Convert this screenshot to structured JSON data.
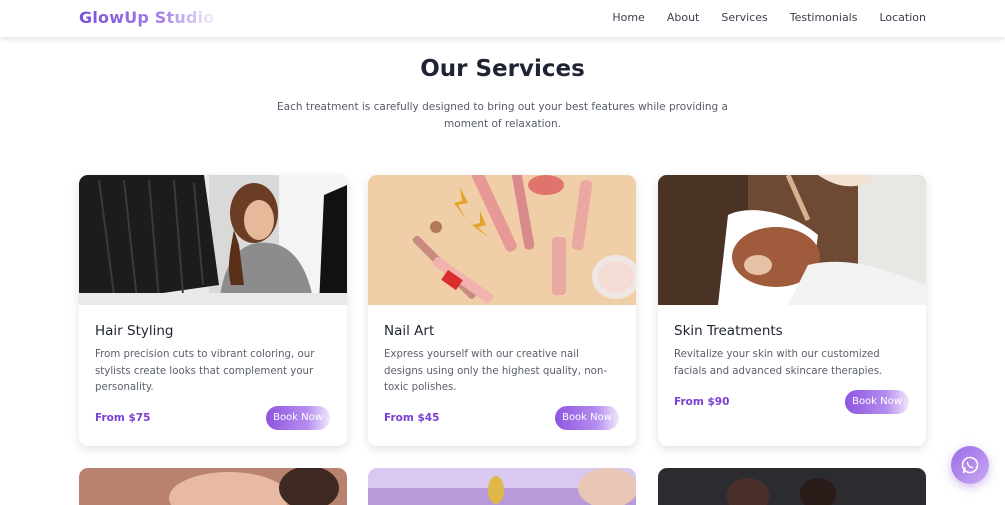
{
  "nav": {
    "brand": "GlowUp Studio",
    "items": [
      "Home",
      "About",
      "Services",
      "Testimonials",
      "Location"
    ]
  },
  "header": {
    "title": "Our Services",
    "subtitle": "Each treatment is carefully designed to bring out your best features while providing a moment of relaxation."
  },
  "services": [
    {
      "title": "Hair Styling",
      "description": "From precision cuts to vibrant coloring, our stylists create looks that complement your personality.",
      "price": "From $75",
      "button": "Book Now"
    },
    {
      "title": "Nail Art",
      "description": "Express yourself with our creative nail designs using only the highest quality, non-toxic polishes.",
      "price": "From $45",
      "button": "Book Now"
    },
    {
      "title": "Skin Treatments",
      "description": "Revitalize your skin with our customized facials and advanced skincare therapies.",
      "price": "From $90",
      "button": "Book Now"
    }
  ],
  "colors": {
    "accent": "#7a3fd6",
    "button_start": "#8e55e0",
    "title": "#1f2433"
  },
  "icons": {
    "chat": "whatsapp-icon"
  }
}
